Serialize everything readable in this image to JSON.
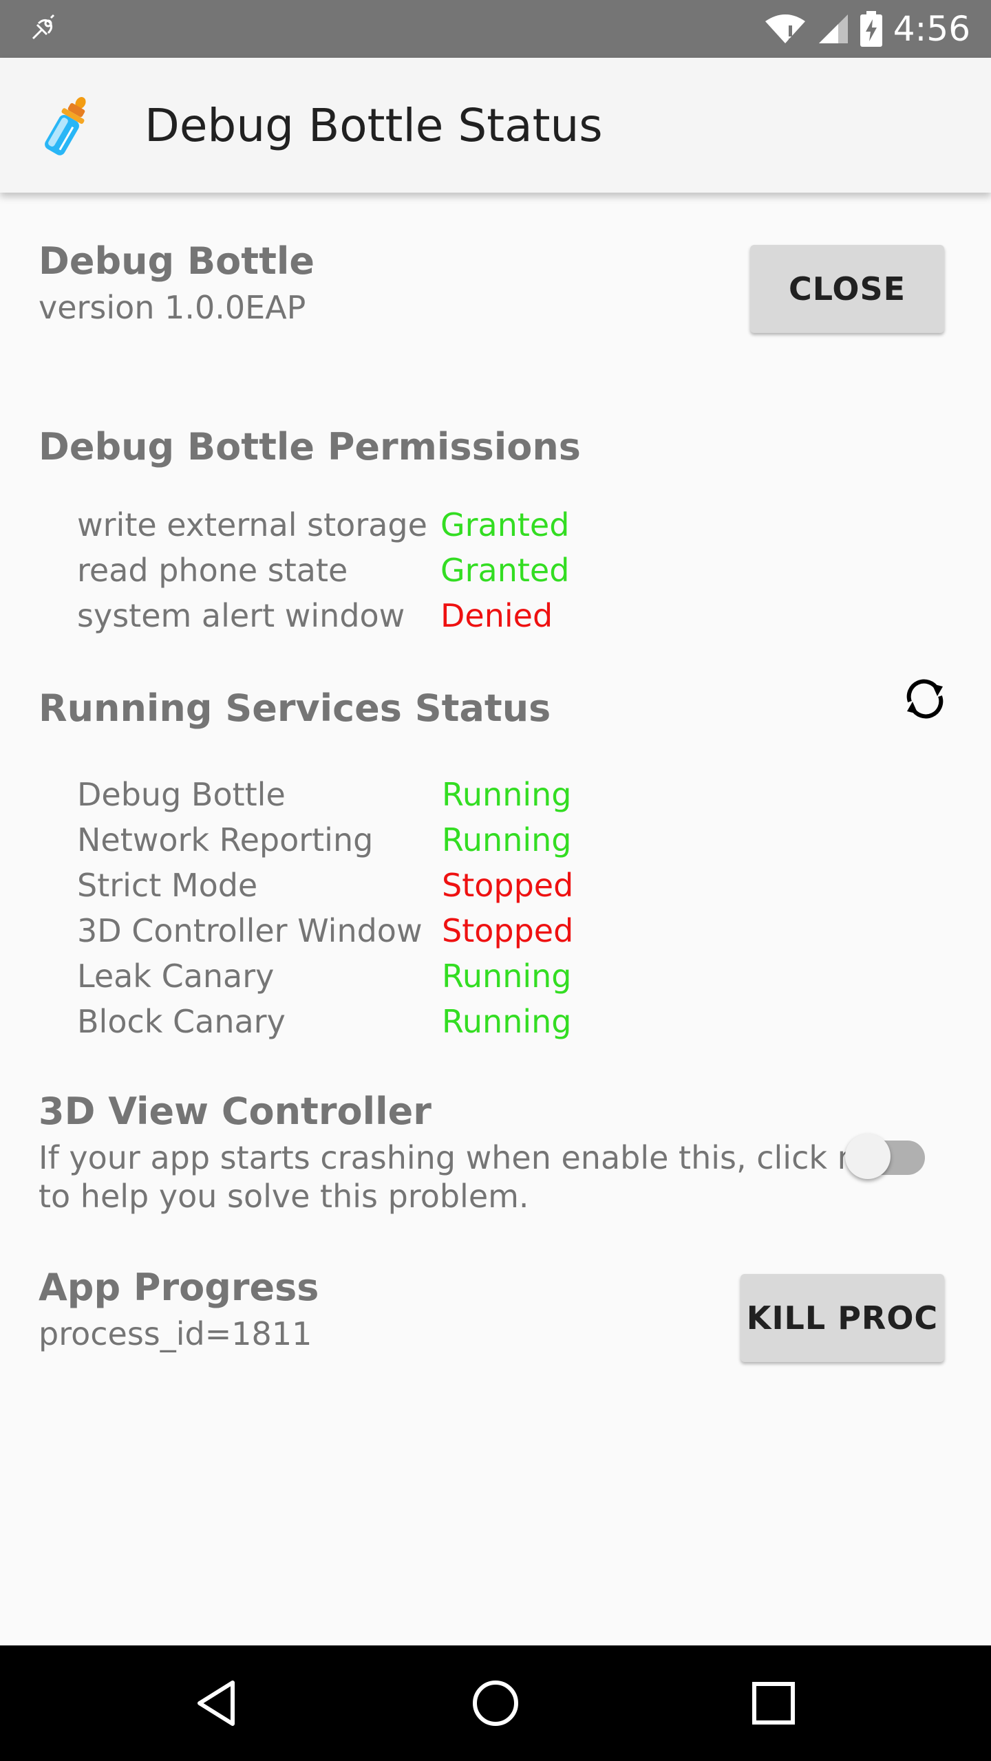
{
  "status_bar": {
    "time": "4:56",
    "icons": [
      "debug-icon",
      "wifi-icon",
      "signal-icon",
      "battery-charging-icon"
    ]
  },
  "app_bar": {
    "title": "Debug Bottle Status",
    "logo_icon": "baby-bottle-icon"
  },
  "header": {
    "app_name": "Debug Bottle",
    "version": "version 1.0.0EAP",
    "close_label": "CLOSE"
  },
  "permissions": {
    "title": "Debug Bottle Permissions",
    "items": [
      {
        "label": "write external storage",
        "status": "Granted"
      },
      {
        "label": "read phone state",
        "status": "Granted"
      },
      {
        "label": "system alert window",
        "status": "Denied"
      }
    ]
  },
  "services": {
    "title": "Running Services Status",
    "refresh_icon": "refresh-icon",
    "items": [
      {
        "label": "Debug Bottle",
        "status": "Running"
      },
      {
        "label": "Network Reporting",
        "status": "Running"
      },
      {
        "label": "Strict Mode",
        "status": "Stopped"
      },
      {
        "label": "3D Controller Window",
        "status": "Stopped"
      },
      {
        "label": "Leak Canary",
        "status": "Running"
      },
      {
        "label": "Block Canary",
        "status": "Running"
      }
    ]
  },
  "view_controller": {
    "title": "3D View Controller",
    "description_line1": "If your app starts crashing when enable this, click me",
    "description_line2": "to help you solve this problem.",
    "toggle_on": false
  },
  "app_progress": {
    "title": "App Progress",
    "process": "process_id=1811",
    "kill_label": "KILL PROC"
  },
  "nav_bar": {
    "icons": [
      "back-icon",
      "home-icon",
      "recents-icon"
    ]
  },
  "colors": {
    "granted": "#33dd22",
    "denied": "#ee1111",
    "text_grey": "#757575",
    "status_bar": "#757575"
  }
}
